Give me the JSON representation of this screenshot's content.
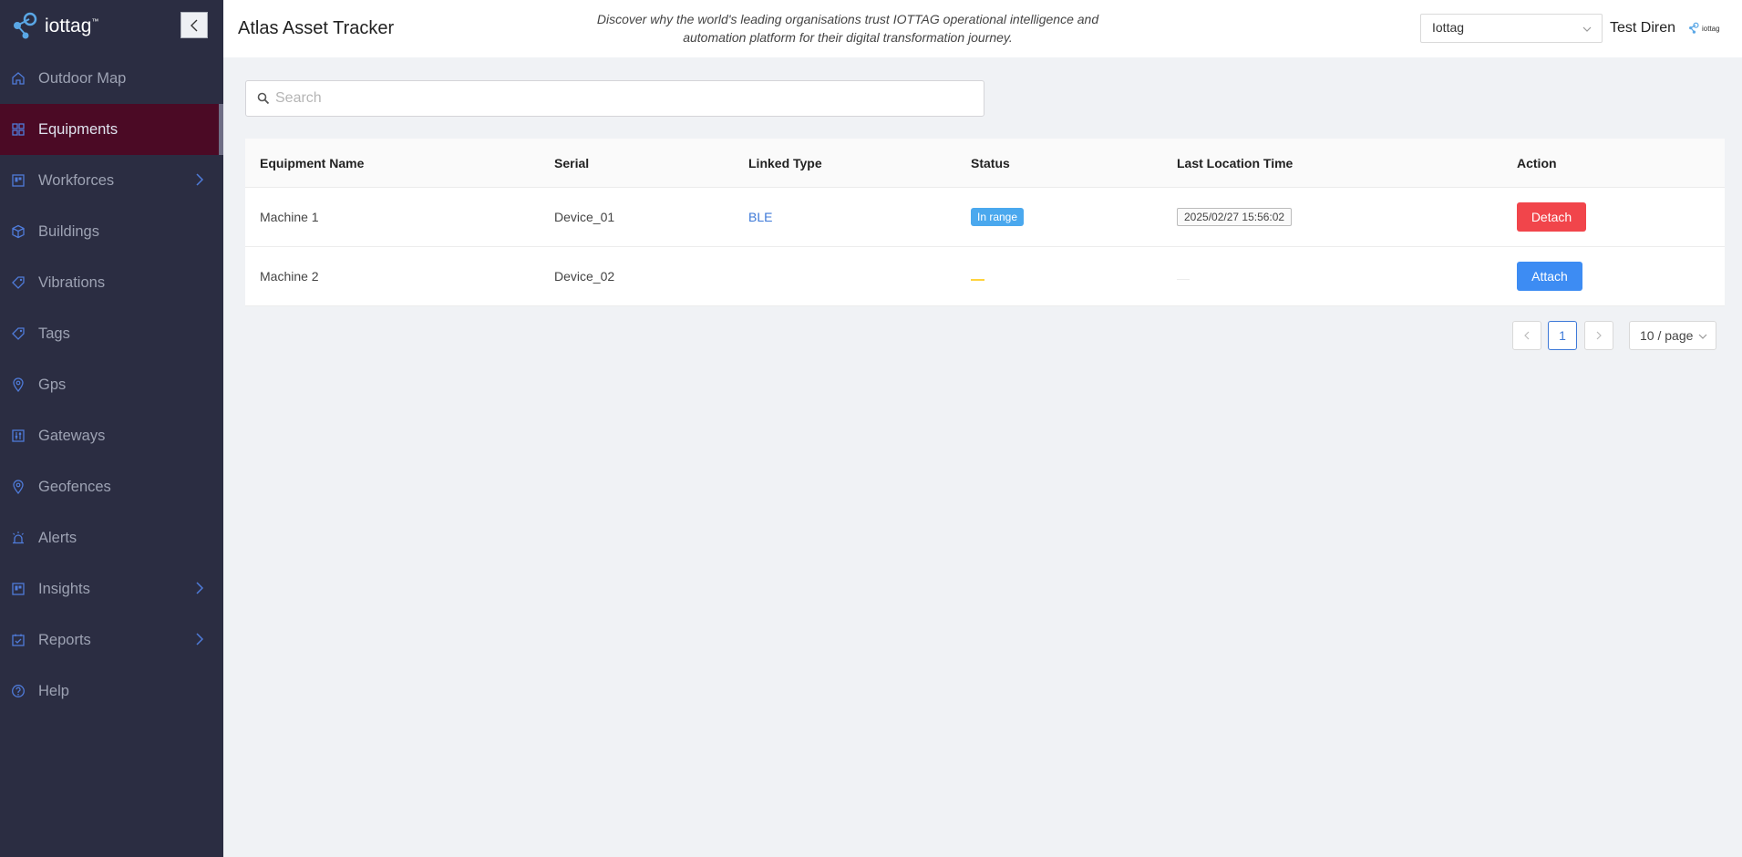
{
  "brand": {
    "name": "iottag",
    "trademark": "™",
    "small_name": "iottag"
  },
  "sidebar": {
    "items": [
      {
        "label": "Outdoor Map",
        "icon": "home-icon",
        "active": false,
        "arrow": false
      },
      {
        "label": "Equipments",
        "icon": "grid-icon",
        "active": true,
        "arrow": false
      },
      {
        "label": "Workforces",
        "icon": "board-icon",
        "active": false,
        "arrow": true
      },
      {
        "label": "Buildings",
        "icon": "cube-icon",
        "active": false,
        "arrow": false
      },
      {
        "label": "Vibrations",
        "icon": "tag-icon",
        "active": false,
        "arrow": false
      },
      {
        "label": "Tags",
        "icon": "tag-icon",
        "active": false,
        "arrow": false
      },
      {
        "label": "Gps",
        "icon": "location-pin-icon",
        "active": false,
        "arrow": false
      },
      {
        "label": "Gateways",
        "icon": "sliders-icon",
        "active": false,
        "arrow": false
      },
      {
        "label": "Geofences",
        "icon": "location-pin-icon",
        "active": false,
        "arrow": false
      },
      {
        "label": "Alerts",
        "icon": "alarm-icon",
        "active": false,
        "arrow": false
      },
      {
        "label": "Insights",
        "icon": "board-icon",
        "active": false,
        "arrow": true
      },
      {
        "label": "Reports",
        "icon": "checklist-icon",
        "active": false,
        "arrow": true
      },
      {
        "label": "Help",
        "icon": "help-circle-icon",
        "active": false,
        "arrow": false
      }
    ]
  },
  "header": {
    "title": "Atlas Asset Tracker",
    "tagline": "Discover why the world's leading organisations trust IOTTAG operational intelligence and automation platform for their digital transformation journey.",
    "org_select": "Iottag",
    "user_name": "Test Diren"
  },
  "search": {
    "placeholder": "Search",
    "value": ""
  },
  "table": {
    "columns": [
      "Equipment Name",
      "Serial",
      "Linked Type",
      "Status",
      "Last Location Time",
      "Action"
    ],
    "rows": [
      {
        "name": "Machine 1",
        "serial": "Device_01",
        "linked_type": "BLE",
        "status": "In range",
        "last_location_time": "2025/02/27 15:56:02",
        "action": "Detach"
      },
      {
        "name": "Machine 2",
        "serial": "Device_02",
        "linked_type": "",
        "status": "",
        "last_location_time": "",
        "action": "Attach"
      }
    ]
  },
  "pagination": {
    "current_page": "1",
    "page_size": "10 / page"
  },
  "colors": {
    "sidebar_bg": "#2b2d42",
    "active_item_bg": "#4b0a25",
    "icon_blue": "#4f7bd9",
    "detach_red": "#f1454b",
    "attach_blue": "#3d8cf3",
    "in_range": "#4aa8ee"
  }
}
